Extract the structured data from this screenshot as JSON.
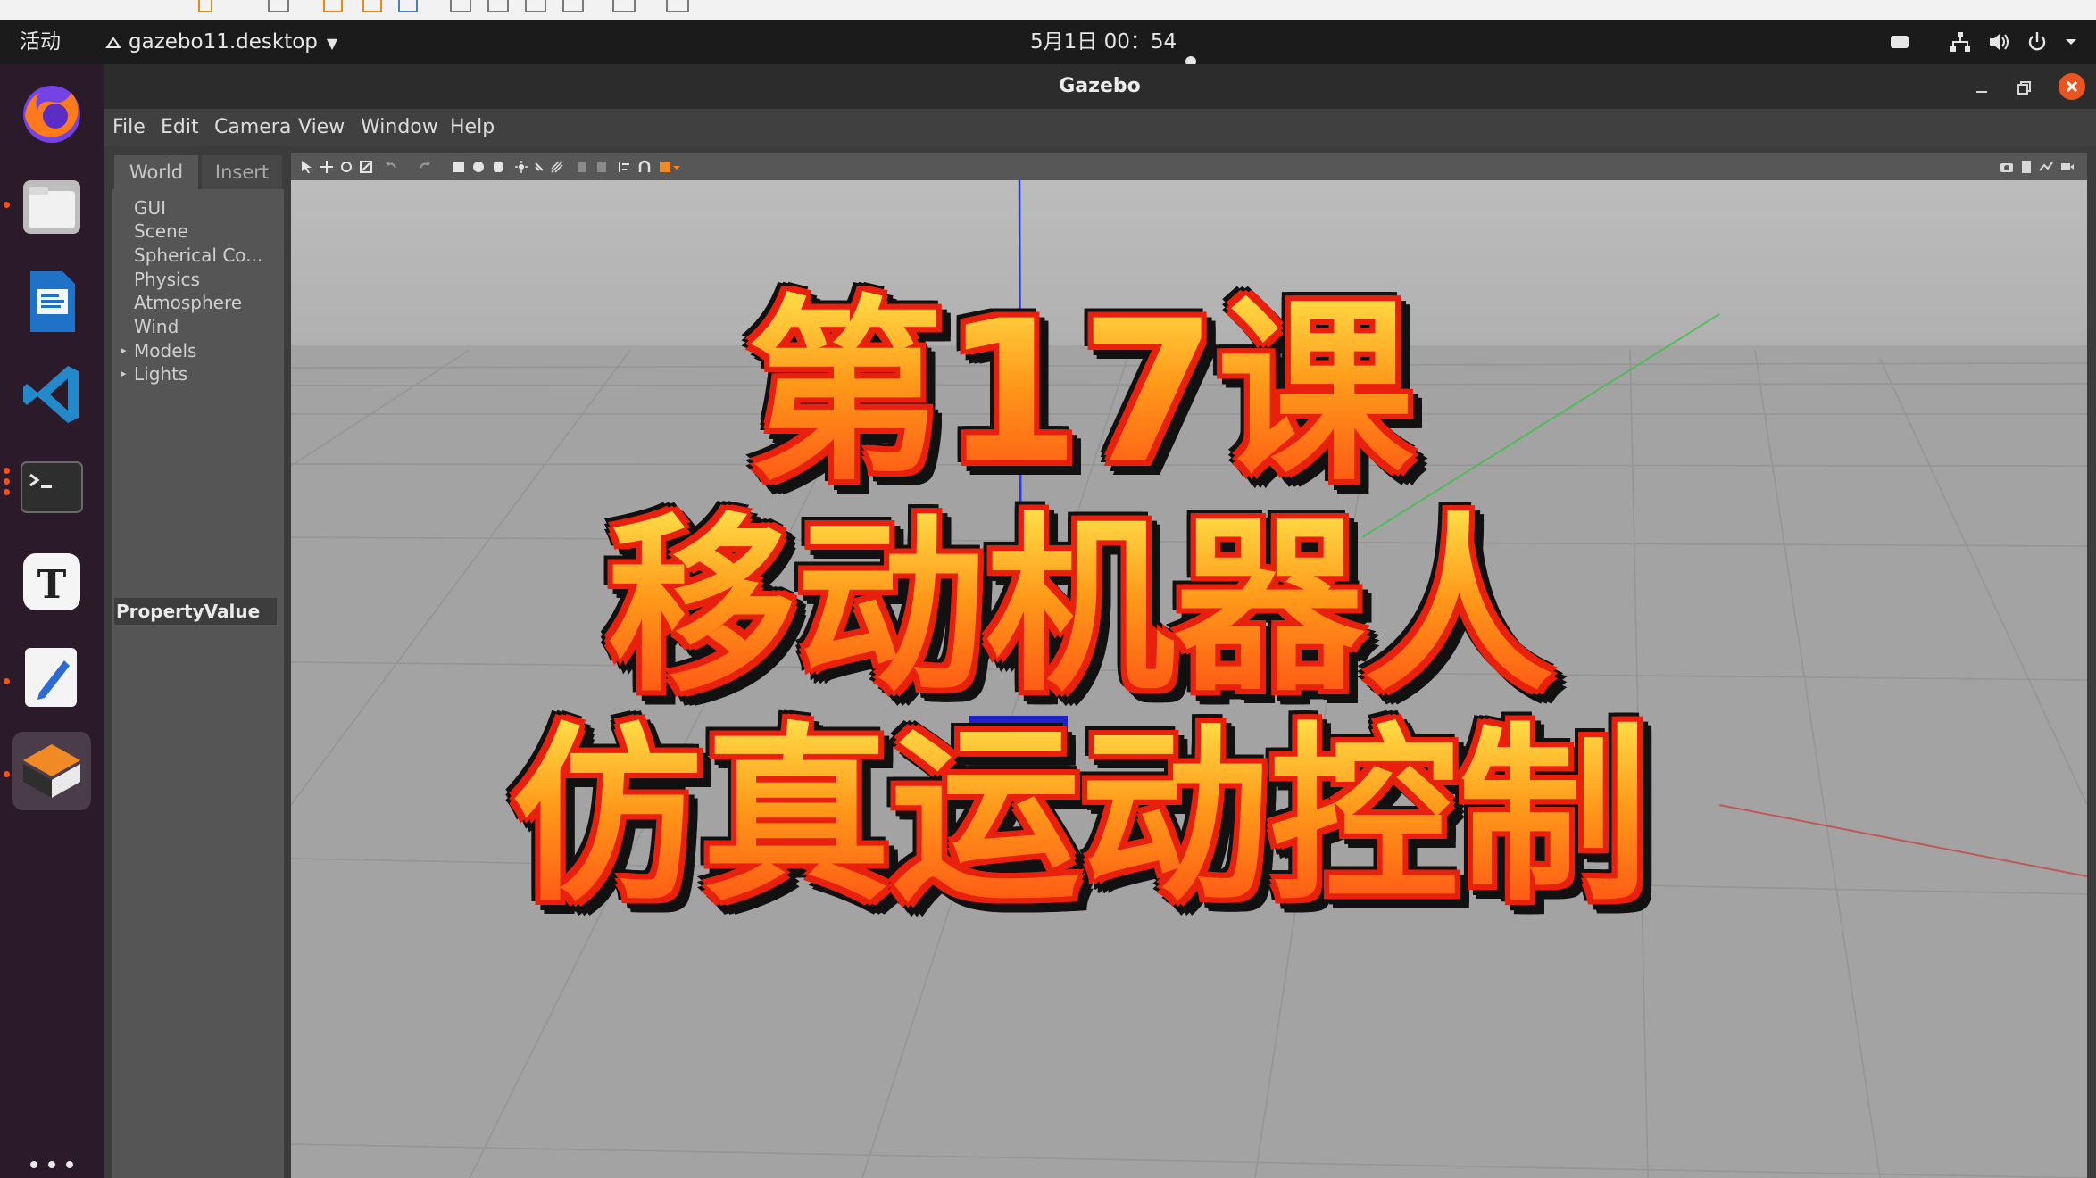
{
  "system_bar": {
    "activities": "活动",
    "app_name": "gazebo11.desktop",
    "clock": "5月1日  00：54"
  },
  "dock": {
    "items": [
      "firefox-icon",
      "files-icon",
      "libreoffice-writer-icon",
      "vscode-icon",
      "terminal-icon",
      "typora-icon",
      "text-editor-icon",
      "gazebo-icon"
    ]
  },
  "window": {
    "title": "Gazebo",
    "menus": [
      "File",
      "Edit",
      "Camera",
      "View",
      "Window",
      "Help"
    ]
  },
  "left_panel": {
    "tabs": [
      "World",
      "Insert"
    ],
    "tree": [
      "GUI",
      "Scene",
      "Spherical Co...",
      "Physics",
      "Atmosphere",
      "Wind",
      "Models",
      "Lights"
    ],
    "property_header": "PropertyValue"
  },
  "overlay": {
    "line1": "第17课",
    "line2": "移动机器人",
    "line3": "仿真运动控制"
  },
  "colors": {
    "accent": "#e95420",
    "viewport_floor": "#a4a4a4",
    "caption_fill": "#ff9a1a",
    "caption_outline": "#e8200d"
  }
}
